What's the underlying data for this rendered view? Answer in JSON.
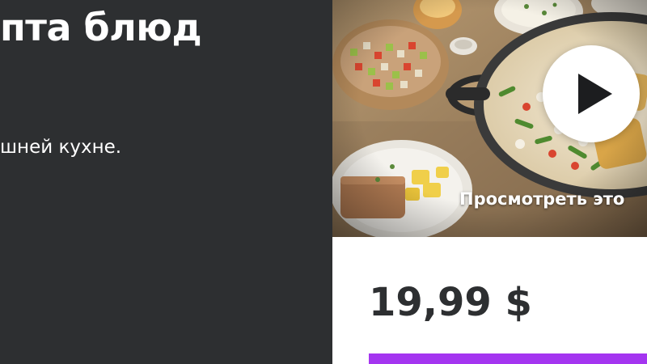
{
  "hero": {
    "title": "пта блюд",
    "subtitle": "шней кухне."
  },
  "card": {
    "preview_label": "Просмотреть это",
    "price": "19,99 $",
    "cta_label": ""
  },
  "colors": {
    "page_bg": "#2d2f31",
    "card_bg": "#ffffff",
    "text_dark": "#2d2f31",
    "accent": "#a435f0"
  },
  "icons": {
    "play": "play-icon"
  }
}
